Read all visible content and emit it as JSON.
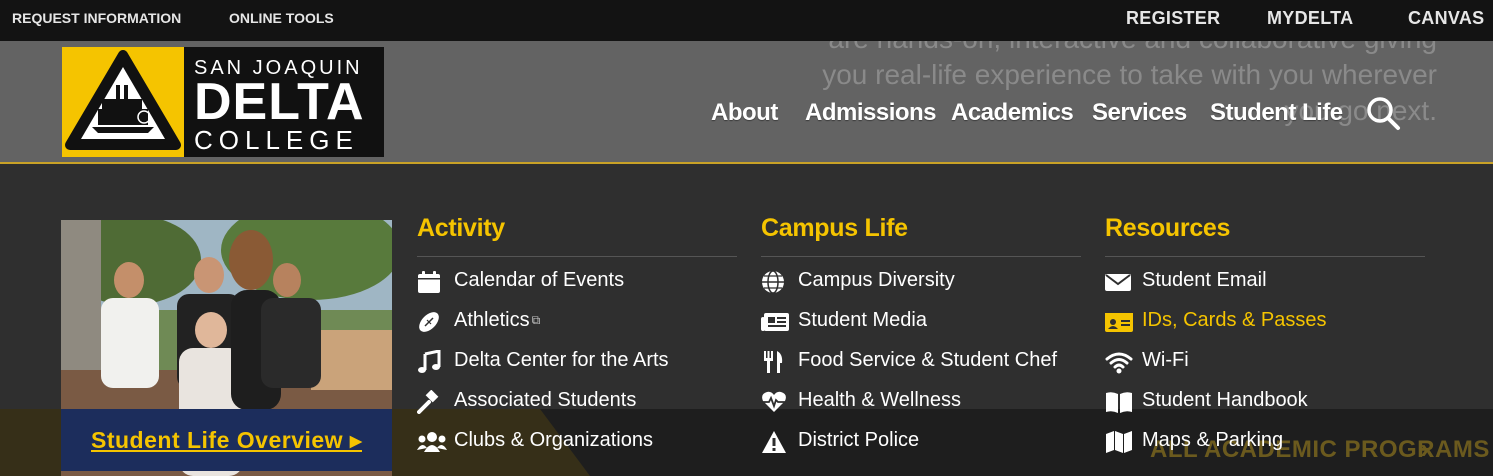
{
  "topbar": {
    "left": [
      "REQUEST INFORMATION",
      "ONLINE TOOLS"
    ],
    "right": [
      "REGISTER",
      "MYDELTA",
      "CANVAS"
    ]
  },
  "logo": {
    "line1": "SAN JOAQUIN",
    "line2": "DELTA",
    "line3": "COLLEGE"
  },
  "nav": [
    "About",
    "Admissions",
    "Academics",
    "Services",
    "Student Life"
  ],
  "background_text": "are hands-on, interactive and collaborative giving you real-life experience to take with you wherever you go next.",
  "cta": {
    "label": "Student Life Overview ▸"
  },
  "columns": [
    {
      "title": "Activity",
      "items": [
        {
          "label": "Calendar of Events",
          "icon": "calendar-icon"
        },
        {
          "label": "Athletics",
          "icon": "football-icon",
          "external": true
        },
        {
          "label": "Delta Center for the Arts",
          "icon": "music-note-icon"
        },
        {
          "label": "Associated Students",
          "icon": "gavel-icon"
        },
        {
          "label": "Clubs & Organizations",
          "icon": "users-icon"
        }
      ]
    },
    {
      "title": "Campus Life",
      "items": [
        {
          "label": "Campus Diversity",
          "icon": "globe-icon"
        },
        {
          "label": "Student Media",
          "icon": "newspaper-icon"
        },
        {
          "label": "Food Service & Student Chef",
          "icon": "utensils-icon"
        },
        {
          "label": "Health & Wellness",
          "icon": "heartbeat-icon"
        },
        {
          "label": "District Police",
          "icon": "warning-icon"
        }
      ]
    },
    {
      "title": "Resources",
      "items": [
        {
          "label": "Student Email",
          "icon": "envelope-icon"
        },
        {
          "label": "IDs, Cards & Passes",
          "icon": "id-card-icon",
          "highlight": true
        },
        {
          "label": "Wi-Fi",
          "icon": "wifi-icon"
        },
        {
          "label": "Student Handbook",
          "icon": "book-icon"
        },
        {
          "label": "Maps & Parking",
          "icon": "map-icon"
        }
      ]
    }
  ],
  "ghost_link": "ALL ACADEMIC PROGRAMS",
  "colors": {
    "accent": "#f5c400",
    "cta_bg": "#1c2d5c",
    "panel_bg": "#2f2f2f",
    "topbar_bg": "#131313"
  }
}
